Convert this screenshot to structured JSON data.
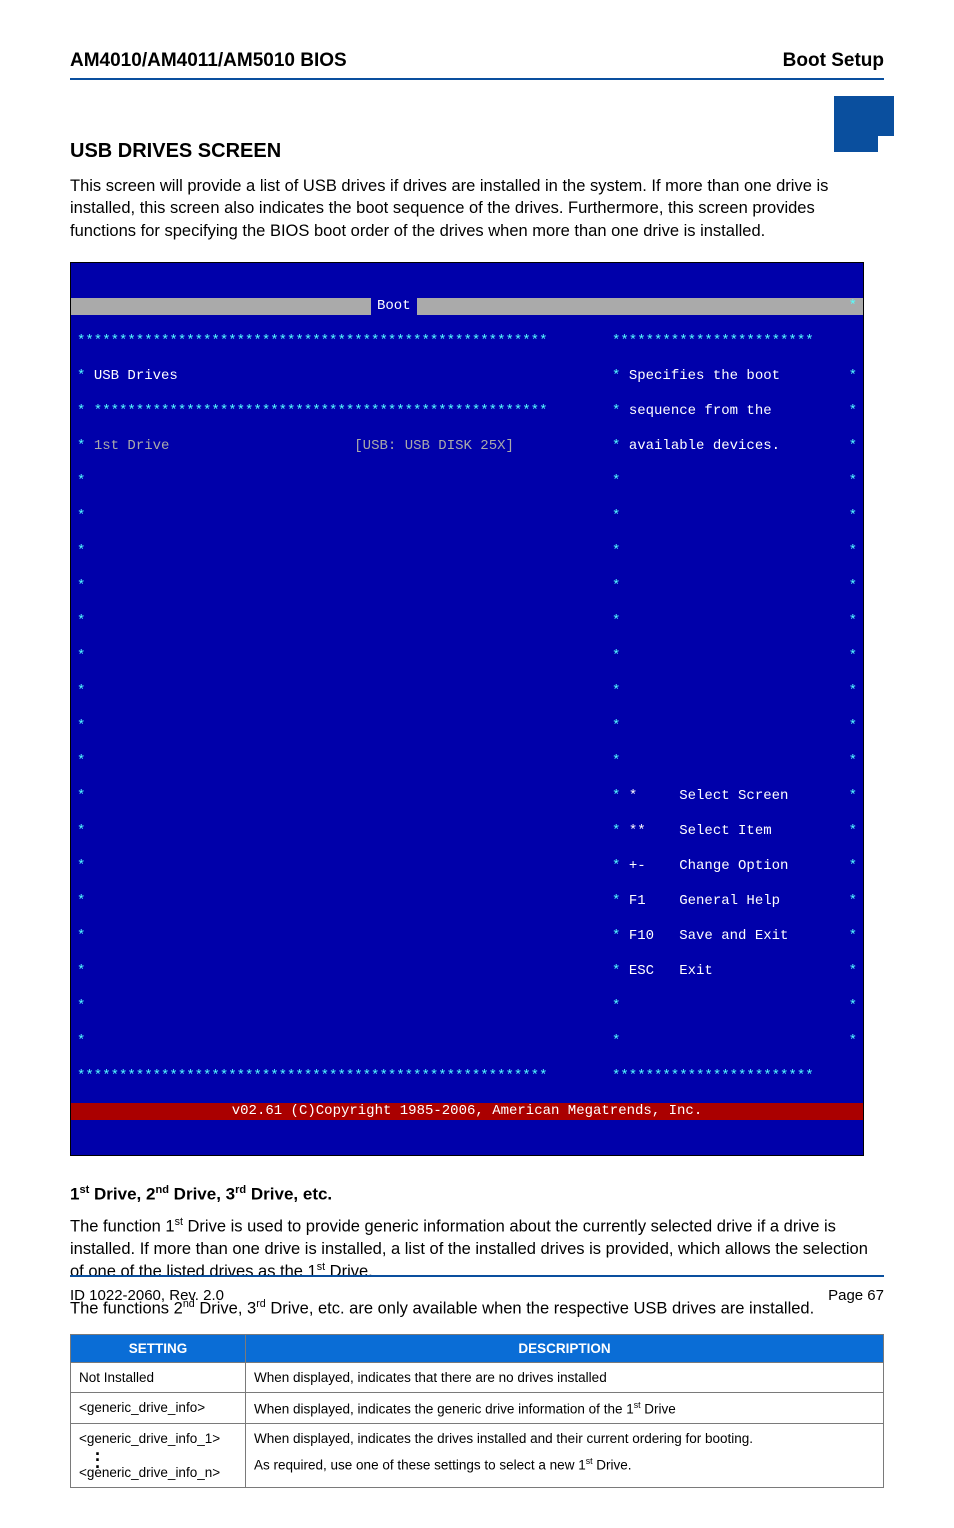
{
  "header": {
    "left": "AM4010/AM4011/AM5010 BIOS",
    "right": "Boot Setup"
  },
  "section_title": "USB DRIVES SCREEN",
  "intro": "This screen will provide a list of USB drives if drives are installed in the system. If more than one drive is installed, this screen also indicates the boot sequence of the drives. Furthermore, this screen provides functions for specifying the BIOS boot order of the drives when more than one drive is installed.",
  "bios": {
    "tab": "Boot",
    "title_left": "USB Drives",
    "row1_label": "1st Drive",
    "row1_value": "[USB: USB DISK 25X]",
    "help1": "Specifies the boot",
    "help2": "sequence from the",
    "help3": "available devices.",
    "keys": {
      "k0": "*     Select Screen",
      "k1": "**    Select Item",
      "k2": "+-    Change Option",
      "k3": "F1    General Help",
      "k4": "F10   Save and Exit",
      "k5": "ESC   Exit"
    },
    "footer": "v02.61 (C)Copyright 1985-2006, American Megatrends, Inc."
  },
  "subheading_html": "1<sup>st</sup> Drive, 2<sup>nd</sup> Drive, 3<sup>rd</sup> Drive, etc.",
  "para1_pre": "The function 1",
  "para1_sup1": "st",
  "para1_mid": " Drive is used to provide generic information about the currently selected drive if a drive is installed. If more than one drive is installed, a list of the installed drives is provided, which allows the selection of one of the listed drives as the 1",
  "para1_sup2": "st",
  "para1_post": " Drive.",
  "para2_pre": "The functions 2",
  "para2_sup1": "nd",
  "para2_mid1": " Drive, 3",
  "para2_sup2": "rd",
  "para2_mid2": " Drive, etc. are only available when the respective USB drives are installed.",
  "table": {
    "h1": "SETTING",
    "h2": "DESCRIPTION",
    "r1c1": "Not Installed",
    "r1c2": "When displayed, indicates that there are no drives installed",
    "r2c1": "<generic_drive_info>",
    "r2c2_pre": "When displayed, indicates the generic drive information of the 1",
    "r2c2_sup": "st",
    "r2c2_post": " Drive",
    "r3c1a": "<generic_drive_info_1>",
    "r3c1b": "<generic_drive_info_n>",
    "r3c2_l1": "When displayed, indicates the drives installed and their current ordering for booting.",
    "r3c2_l2_pre": "As required, use one of these settings to select a new 1",
    "r3c2_l2_sup": "st",
    "r3c2_l2_post": " Drive."
  },
  "footer": {
    "left": "ID 1022-2060, Rev. 2.0",
    "right": "Page 67"
  }
}
